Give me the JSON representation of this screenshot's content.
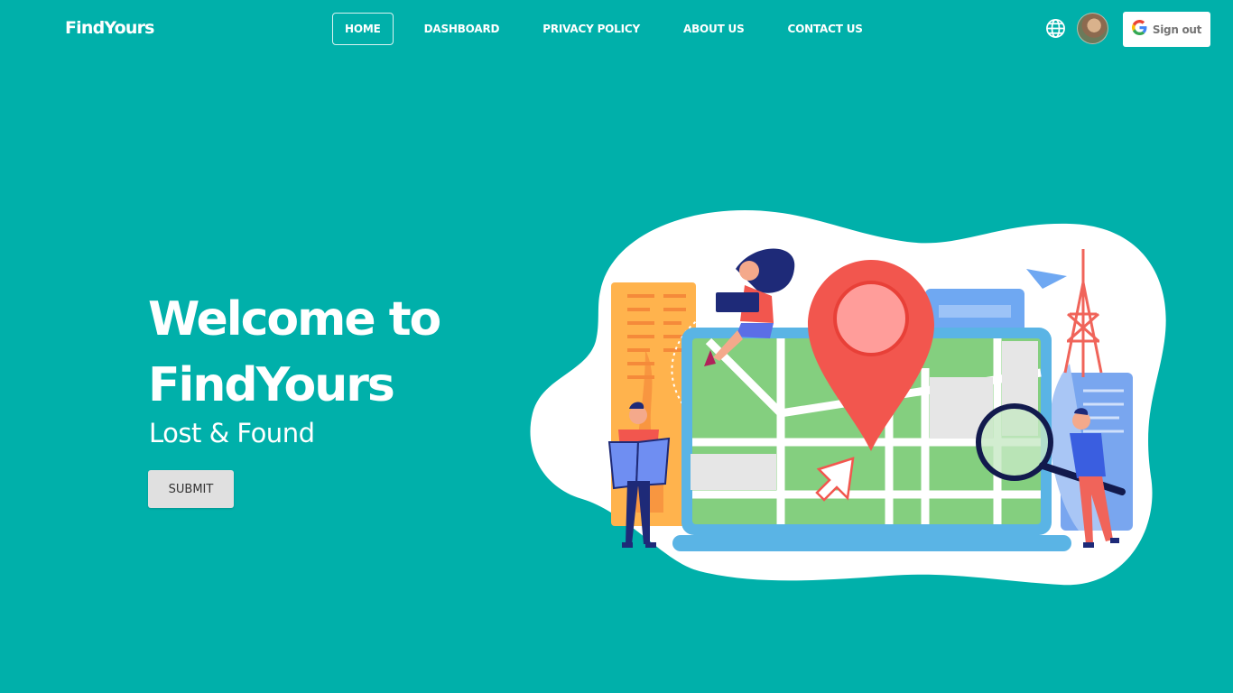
{
  "navbar": {
    "brand": "FindYours",
    "links": [
      {
        "label": "HOME",
        "active": true
      },
      {
        "label": "DASHBOARD",
        "active": false
      },
      {
        "label": "PRIVACY POLICY",
        "active": false
      },
      {
        "label": "ABOUT US",
        "active": false
      },
      {
        "label": "CONTACT US",
        "active": false
      }
    ],
    "icons": {
      "language": "globe-icon",
      "avatar": "user-avatar",
      "google": "google-logo-icon"
    },
    "signout_label": "Sign out"
  },
  "hero": {
    "title_line1": "Welcome to",
    "title_line2": "FindYours",
    "subtitle": "Lost & Found",
    "button_label": "SUBMIT"
  },
  "colors": {
    "background": "#00b0aa",
    "pin": "#f2564e",
    "map_green": "#84cf7f",
    "laptop_blue": "#5ab4e5"
  }
}
